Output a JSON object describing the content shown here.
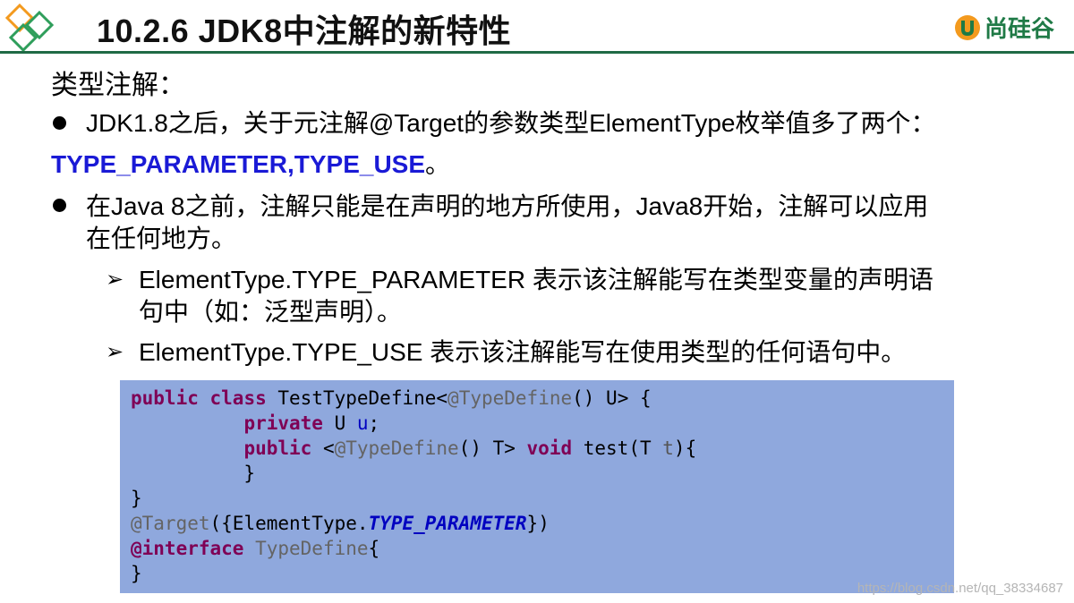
{
  "header": {
    "title": "10.2.6 JDK8中注解的新特性",
    "brand_name": "尚硅谷"
  },
  "section_heading": "类型注解：",
  "bullets": [
    {
      "line": "JDK1.8之后，关于元注解@Target的参数类型ElementType枚举值多了两个：",
      "highlight": "TYPE_PARAMETER,TYPE_USE",
      "highlight_tail": "。"
    },
    {
      "line_a": "在Java  8之前，注解只能是在声明的地方所使用，Java8开始，注解可以应用",
      "line_b": "在任何地方。"
    }
  ],
  "sub_bullets": [
    {
      "line_a": "ElementType.TYPE_PARAMETER  表示该注解能写在类型变量的声明语",
      "line_b": "句中（如：泛型声明）。"
    },
    {
      "line_a": "ElementType.TYPE_USE 表示该注解能写在使用类型的任何语句中。"
    }
  ],
  "code": {
    "l1": {
      "kw1": "public",
      "kw2": "class",
      "name": "TestTypeDefine<",
      "ann": "@TypeDefine",
      "rest": "() U> {"
    },
    "l2": {
      "indent": "          ",
      "kw": "private",
      "type": " U ",
      "field": "u",
      "end": ";"
    },
    "l3": {
      "indent": "          ",
      "kw": "public",
      "pre": " <",
      "ann": "@TypeDefine",
      "mid": "() T> ",
      "kw2": "void",
      "rest": " test(T ",
      "param": "t",
      "end": "){"
    },
    "l4": {
      "text": "          }"
    },
    "l5": {
      "text": "}"
    },
    "l6": {
      "ann": "@Target",
      "pre": "({ElementType.",
      "const": "TYPE_PARAMETER",
      "end": "})"
    },
    "l7": {
      "kw": "@interface",
      "sp": " ",
      "name": "TypeDefine",
      "end": "{"
    },
    "l8": {
      "text": "}"
    }
  },
  "watermark": "https://blog.csdn.net/qq_38334687",
  "colors": {
    "title_rule": "#1f6a45",
    "brand": "#1f7a46",
    "highlight": "#1a1ad6",
    "code_bg": "#8fa8dd",
    "keyword": "#7f0055"
  },
  "icons": {
    "logo": "orange-green-diamonds-icon",
    "brand": "u-shield-icon"
  }
}
